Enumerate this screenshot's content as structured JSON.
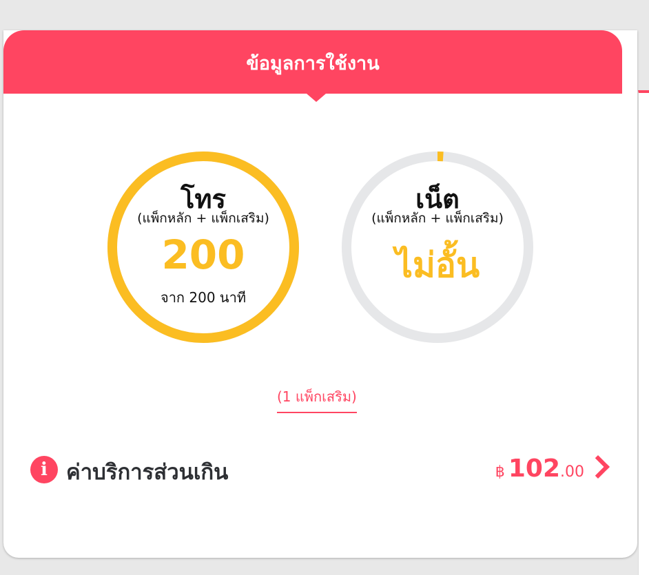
{
  "header": {
    "title": "ข้อมูลการใช้งาน"
  },
  "gauges": [
    {
      "title": "โทร",
      "subtitle": "(แพ็กหลัก + แพ็กเสริม)",
      "value": "200",
      "note": "จาก 200 นาที",
      "remaining_fraction": 1.0,
      "color": "#fbbd22"
    },
    {
      "title": "เน็ต",
      "subtitle": "(แพ็กหลัก + แพ็กเสริม)",
      "value": "ไม่อั้น",
      "note": "",
      "remaining_fraction": 0.01,
      "color": "#fbbd22"
    }
  ],
  "addon": {
    "label": "(1 แพ็กเสริม)"
  },
  "overage": {
    "label": "ค่าบริการส่วนเกิน",
    "currency": "฿",
    "amount_whole": "102",
    "amount_cents": ".00"
  },
  "colors": {
    "accent": "#ff4561",
    "gauge_fill": "#fbbd22",
    "gauge_track": "#e6e7e9"
  },
  "icons": {
    "info": "info-icon",
    "chevron": "chevron-right-icon"
  }
}
